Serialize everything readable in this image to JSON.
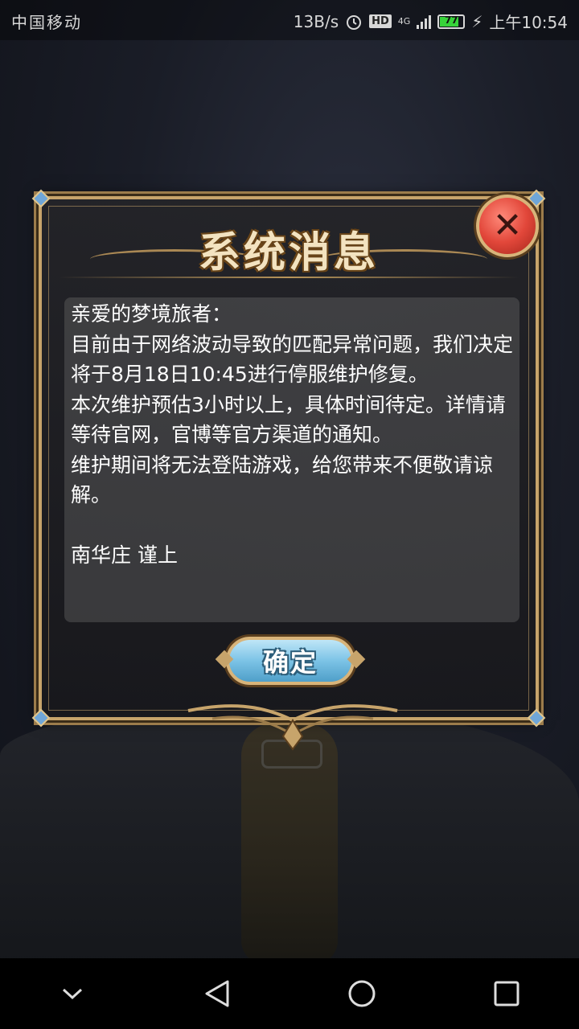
{
  "status_bar": {
    "carrier": "中国移动",
    "net_speed": "13B/s",
    "hd_badge": "HD",
    "network_type": "4G",
    "battery_level": "77",
    "time": "上午10:54"
  },
  "dialog": {
    "title": "系统消息",
    "close_symbol": "✕",
    "message": {
      "greeting": "亲爱的梦境旅者：",
      "line1": "目前由于网络波动导致的匹配异常问题，我们决定将于8月18日10:45进行停服维护修复。",
      "line2": "本次维护预估3小时以上，具体时间待定。详情请等待官网，官博等官方渠道的通知。",
      "line3": "维护期间将无法登陆游戏，给您带来不便敬请谅解。",
      "signature": "南华庄 谨上"
    },
    "ok_label": "确定"
  },
  "nav_bar": {
    "icons": [
      "chevron-down-icon",
      "back-icon",
      "home-icon",
      "recents-icon"
    ]
  },
  "colors": {
    "frame_gold": "#c7a46b",
    "close_red": "#e2473a",
    "button_blue": "#7cc3e6",
    "battery_green": "#37d33a"
  }
}
